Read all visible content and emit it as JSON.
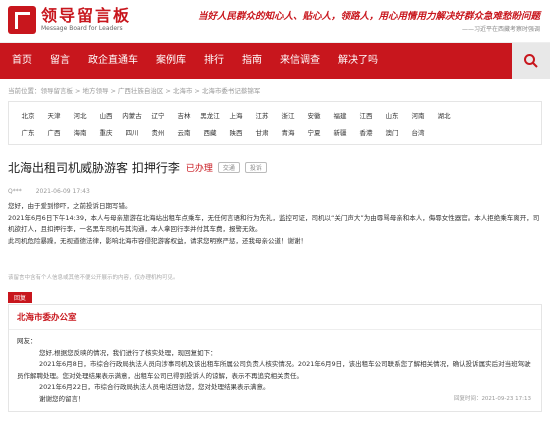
{
  "logo": {
    "cn": "领导留言板",
    "en": "Message Board for Leaders"
  },
  "banner": {
    "main": "当好人民群众的知心人、贴心人，领路人，用心用情用力解决好群众急难愁盼问题",
    "sub": "——习近平在西藏考察时强调"
  },
  "nav": [
    "首页",
    "留言",
    "政企直通车",
    "案例库",
    "排行",
    "指南",
    "来信调查",
    "解决了吗"
  ],
  "colors": {
    "brand": "#c8161d"
  },
  "icons": {
    "search": "search-icon"
  },
  "breadcrumb": [
    "当前位置：领导留言板",
    "地方领导",
    "广西壮族自治区",
    "北海市",
    "北海市委书记蔡锦军"
  ],
  "regions": {
    "row1": [
      "北京",
      "天津",
      "河北",
      "山西",
      "内蒙古",
      "辽宁",
      "吉林",
      "黑龙江",
      "上海",
      "江苏",
      "浙江",
      "安徽",
      "福建",
      "江西",
      "山东",
      "河南",
      "湖北"
    ],
    "row2": [
      "广东",
      "广西",
      "海南",
      "重庆",
      "四川",
      "贵州",
      "云南",
      "西藏",
      "陕西",
      "甘肃",
      "青海",
      "宁夏",
      "新疆",
      "香港",
      "澳门",
      "台湾"
    ]
  },
  "message": {
    "title": "北海出租司机威胁游客 扣押行李",
    "status": "已办理",
    "tags": [
      "交通",
      "投诉"
    ],
    "author": "Q***",
    "time": "2021-06-09 17:43",
    "paragraphs": [
      "您好，由于爱到惨吓，之前投诉日期写错。",
      "2021年6月6日下午14:39，本人与母亲旅游在北海站出租车点乘车，无任何言语和行为先礼，监控可证，司机以“关门声大”为由辱骂母亲和本人，侮辱女性器官。本人拒绝乘车离开，司机欲打人，且扣押行李，一名黑车司机与其沟通，本人拿回行李并付其车费，报警无效。",
      "此司机危险暴躁，无视道德法律，影响北海市容侵犯游客权益，请求您明察严惩，还我母亲公道！谢谢！"
    ]
  },
  "disclaimer": "该留言中含有个人信息或其他不便公开展示的内容，仅办理机构可见。",
  "reply": {
    "tag": "回复",
    "org": "北海市委办公室",
    "greeting": "网友：",
    "paragraphs": [
      "您好,根据您反映的情况，我们进行了核实处理，现回复如下：",
      "2021年6月8日，市综合行政局执法人员向涉事司机及该出租车所属公司负责人核实情况。2021年6月9日，该出租车公司联系您了解相关情况，确认投诉属实后对当班驾驶员作解聘处理。您对处理结果表示满意，出租车公司已得到投诉人的谅解，表示不再追究相关责任。",
      "2021年6月22日，市综合行政局执法人员电话回访您，您对处理结果表示满意。",
      "谢谢您的留言！"
    ],
    "time": "回复时间：2021-09-23 17:13"
  }
}
